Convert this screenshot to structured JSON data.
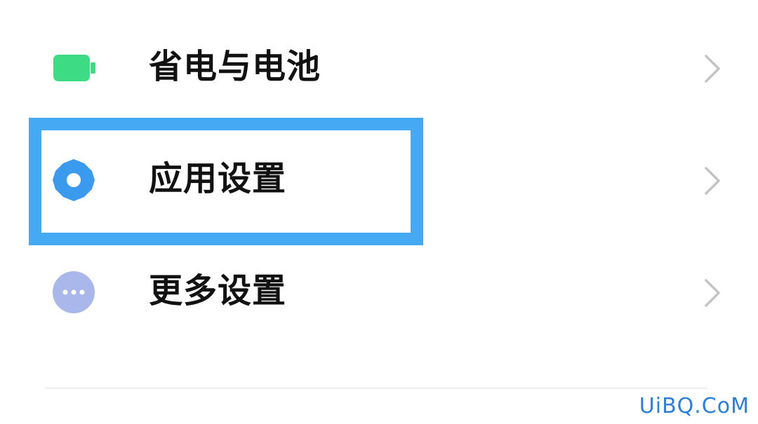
{
  "settings": {
    "items": [
      {
        "label": "省电与电池",
        "icon": "battery-icon",
        "icon_color": "#3ddc84"
      },
      {
        "label": "应用设置",
        "icon": "gear-icon",
        "icon_color": "#3a9bee"
      },
      {
        "label": "更多设置",
        "icon": "more-dots-icon",
        "icon_color": "#a9b7ea"
      }
    ],
    "chevron_color": "#c4c4c4",
    "highlight_color": "#45a9f3"
  },
  "watermark": "UiBQ.CoM"
}
